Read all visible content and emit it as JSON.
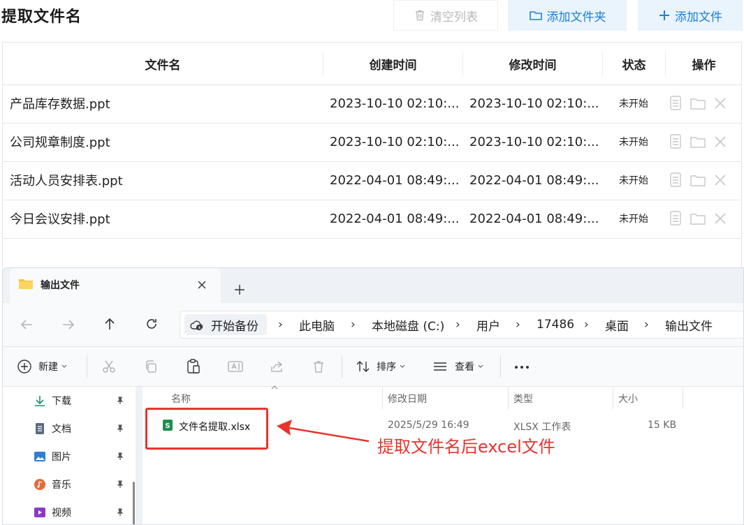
{
  "app": {
    "title": "提取文件名",
    "buttons": {
      "clear": "清空列表",
      "add_folder": "添加文件夹",
      "add_file": "添加文件"
    }
  },
  "table": {
    "headers": {
      "name": "文件名",
      "created": "创建时间",
      "modified": "修改时间",
      "status": "状态",
      "ops": "操作"
    },
    "rows": [
      {
        "name": "产品库存数据.ppt",
        "created": "2023-10-10 02:10:...",
        "modified": "2023-10-10 02:10:...",
        "status": "未开始"
      },
      {
        "name": "公司规章制度.ppt",
        "created": "2023-10-10 02:10:...",
        "modified": "2023-10-10 02:10:...",
        "status": "未开始"
      },
      {
        "name": "活动人员安排表.ppt",
        "created": "2022-04-01 08:49:...",
        "modified": "2022-04-01 08:49:...",
        "status": "未开始"
      },
      {
        "name": "今日会议安排.ppt",
        "created": "2022-04-01 08:49:...",
        "modified": "2022-04-01 08:49:...",
        "status": "未开始"
      }
    ]
  },
  "explorer": {
    "tab_title": "输出文件",
    "breadcrumb": [
      "开始备份",
      "此电脑",
      "本地磁盘 (C:)",
      "用户",
      "17486",
      "桌面",
      "输出文件"
    ],
    "toolbar": {
      "new": "新建",
      "sort": "排序",
      "view": "查看"
    },
    "sidebar": [
      "下载",
      "文档",
      "图片",
      "音乐",
      "视频"
    ],
    "columns": {
      "name": "名称",
      "modified": "修改日期",
      "type": "类型",
      "size": "大小"
    },
    "file": {
      "name": "文件名提取.xlsx",
      "modified": "2025/5/29 16:49",
      "type": "XLSX 工作表",
      "size": "15 KB"
    }
  },
  "annotation": "提取文件名后excel文件",
  "colors": {
    "accent": "#1c7ed6",
    "annotation": "#e8332d",
    "excel": "#1f8f4e"
  }
}
